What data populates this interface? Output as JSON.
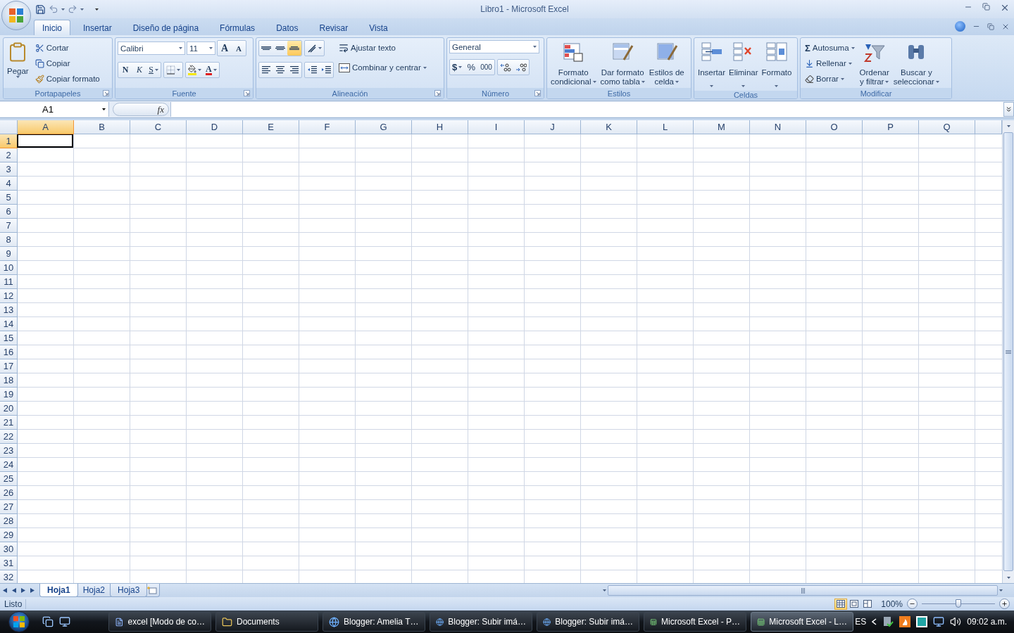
{
  "window": {
    "title": "Libro1 - Microsoft Excel"
  },
  "tabs": [
    {
      "label": "Inicio",
      "selected": true
    },
    {
      "label": "Insertar",
      "selected": false
    },
    {
      "label": "Diseño de página",
      "selected": false
    },
    {
      "label": "Fórmulas",
      "selected": false
    },
    {
      "label": "Datos",
      "selected": false
    },
    {
      "label": "Revisar",
      "selected": false
    },
    {
      "label": "Vista",
      "selected": false
    }
  ],
  "ribbon": [
    {
      "kind": "clipboard",
      "label": "Portapapeles",
      "launcher": true,
      "paste": "Pegar",
      "actions": [
        "Cortar",
        "Copiar",
        "Copiar formato"
      ]
    },
    {
      "kind": "font",
      "label": "Fuente",
      "launcher": true,
      "font": "Calibri",
      "size": "11",
      "grow": "A",
      "shrink": "A",
      "styles": [
        "N",
        "K",
        "S"
      ],
      "color_letter": "A"
    },
    {
      "kind": "alignment",
      "label": "Alineación",
      "launcher": true,
      "vertical_align": [
        {
          "selected": false
        },
        {
          "selected": false
        },
        {
          "selected": true
        }
      ],
      "wrap": "Ajustar texto",
      "merge": "Combinar y centrar"
    },
    {
      "kind": "number",
      "label": "Número",
      "launcher": true,
      "format": "General",
      "symbols": [
        "$",
        "%",
        "000"
      ]
    },
    {
      "kind": "styles",
      "label": "Estilos",
      "launcher": false,
      "buttons": [
        [
          "Formato",
          "condicional"
        ],
        [
          "Dar formato",
          "como tabla"
        ],
        [
          "Estilos de",
          "celda"
        ]
      ]
    },
    {
      "kind": "cells",
      "label": "Celdas",
      "launcher": false,
      "buttons": [
        "Insertar",
        "Eliminar",
        "Formato"
      ]
    },
    {
      "kind": "editing",
      "label": "Modificar",
      "launcher": false,
      "sigma": "Σ",
      "actions": [
        "Autosuma",
        "Rellenar",
        "Borrar"
      ],
      "buttons": [
        [
          "Ordenar",
          "y filtrar"
        ],
        [
          "Buscar y",
          "seleccionar"
        ]
      ]
    }
  ],
  "formula_bar": {
    "name_box": "A1",
    "fx": "fx"
  },
  "sheet": {
    "columns": [
      {
        "label": "A",
        "selected": true
      },
      {
        "label": "B",
        "selected": false
      },
      {
        "label": "C",
        "selected": false
      },
      {
        "label": "D",
        "selected": false
      },
      {
        "label": "E",
        "selected": false
      },
      {
        "label": "F",
        "selected": false
      },
      {
        "label": "G",
        "selected": false
      },
      {
        "label": "H",
        "selected": false
      },
      {
        "label": "I",
        "selected": false
      },
      {
        "label": "J",
        "selected": false
      },
      {
        "label": "K",
        "selected": false
      },
      {
        "label": "L",
        "selected": false
      },
      {
        "label": "M",
        "selected": false
      },
      {
        "label": "N",
        "selected": false
      },
      {
        "label": "O",
        "selected": false
      },
      {
        "label": "P",
        "selected": false
      },
      {
        "label": "Q",
        "selected": false
      }
    ],
    "rows": [
      {
        "label": "1",
        "selected": true
      },
      {
        "label": "2",
        "selected": false
      },
      {
        "label": "3",
        "selected": false
      },
      {
        "label": "4",
        "selected": false
      },
      {
        "label": "5",
        "selected": false
      },
      {
        "label": "6",
        "selected": false
      },
      {
        "label": "7",
        "selected": false
      },
      {
        "label": "8",
        "selected": false
      },
      {
        "label": "9",
        "selected": false
      },
      {
        "label": "10",
        "selected": false
      },
      {
        "label": "11",
        "selected": false
      },
      {
        "label": "12",
        "selected": false
      },
      {
        "label": "13",
        "selected": false
      },
      {
        "label": "14",
        "selected": false
      },
      {
        "label": "15",
        "selected": false
      },
      {
        "label": "16",
        "selected": false
      },
      {
        "label": "17",
        "selected": false
      },
      {
        "label": "18",
        "selected": false
      },
      {
        "label": "19",
        "selected": false
      },
      {
        "label": "20",
        "selected": false
      },
      {
        "label": "21",
        "selected": false
      },
      {
        "label": "22",
        "selected": false
      },
      {
        "label": "23",
        "selected": false
      },
      {
        "label": "24",
        "selected": false
      },
      {
        "label": "25",
        "selected": false
      },
      {
        "label": "26",
        "selected": false
      },
      {
        "label": "27",
        "selected": false
      },
      {
        "label": "28",
        "selected": false
      },
      {
        "label": "29",
        "selected": false
      },
      {
        "label": "30",
        "selected": false
      },
      {
        "label": "31",
        "selected": false
      },
      {
        "label": "32",
        "selected": false
      }
    ]
  },
  "sheet_tabs": [
    {
      "label": "Hoja1",
      "selected": true
    },
    {
      "label": "Hoja2",
      "selected": false
    },
    {
      "label": "Hoja3",
      "selected": false
    }
  ],
  "status_bar": {
    "status": "Listo",
    "views": [
      {
        "selected": true
      },
      {
        "selected": false
      },
      {
        "selected": false
      }
    ],
    "zoom": "100%",
    "zoom_slider": {
      "level": 0.5
    }
  },
  "taskbar": {
    "items": [
      {
        "label": "excel [Modo de co…",
        "kind": "word",
        "selected": false
      },
      {
        "label": "Documents",
        "kind": "folder",
        "selected": false
      },
      {
        "label": "Blogger: Amelia T…",
        "kind": "browser",
        "selected": false
      },
      {
        "label": "Blogger: Subir imá…",
        "kind": "browser",
        "selected": false
      },
      {
        "label": "Blogger: Subir imá…",
        "kind": "browser",
        "selected": false
      },
      {
        "label": "Microsoft Excel - P…",
        "kind": "excel",
        "selected": false
      },
      {
        "label": "Microsoft Excel - L…",
        "kind": "excel",
        "selected": true
      }
    ],
    "language": "ES",
    "clock": "09:02 a.m."
  }
}
